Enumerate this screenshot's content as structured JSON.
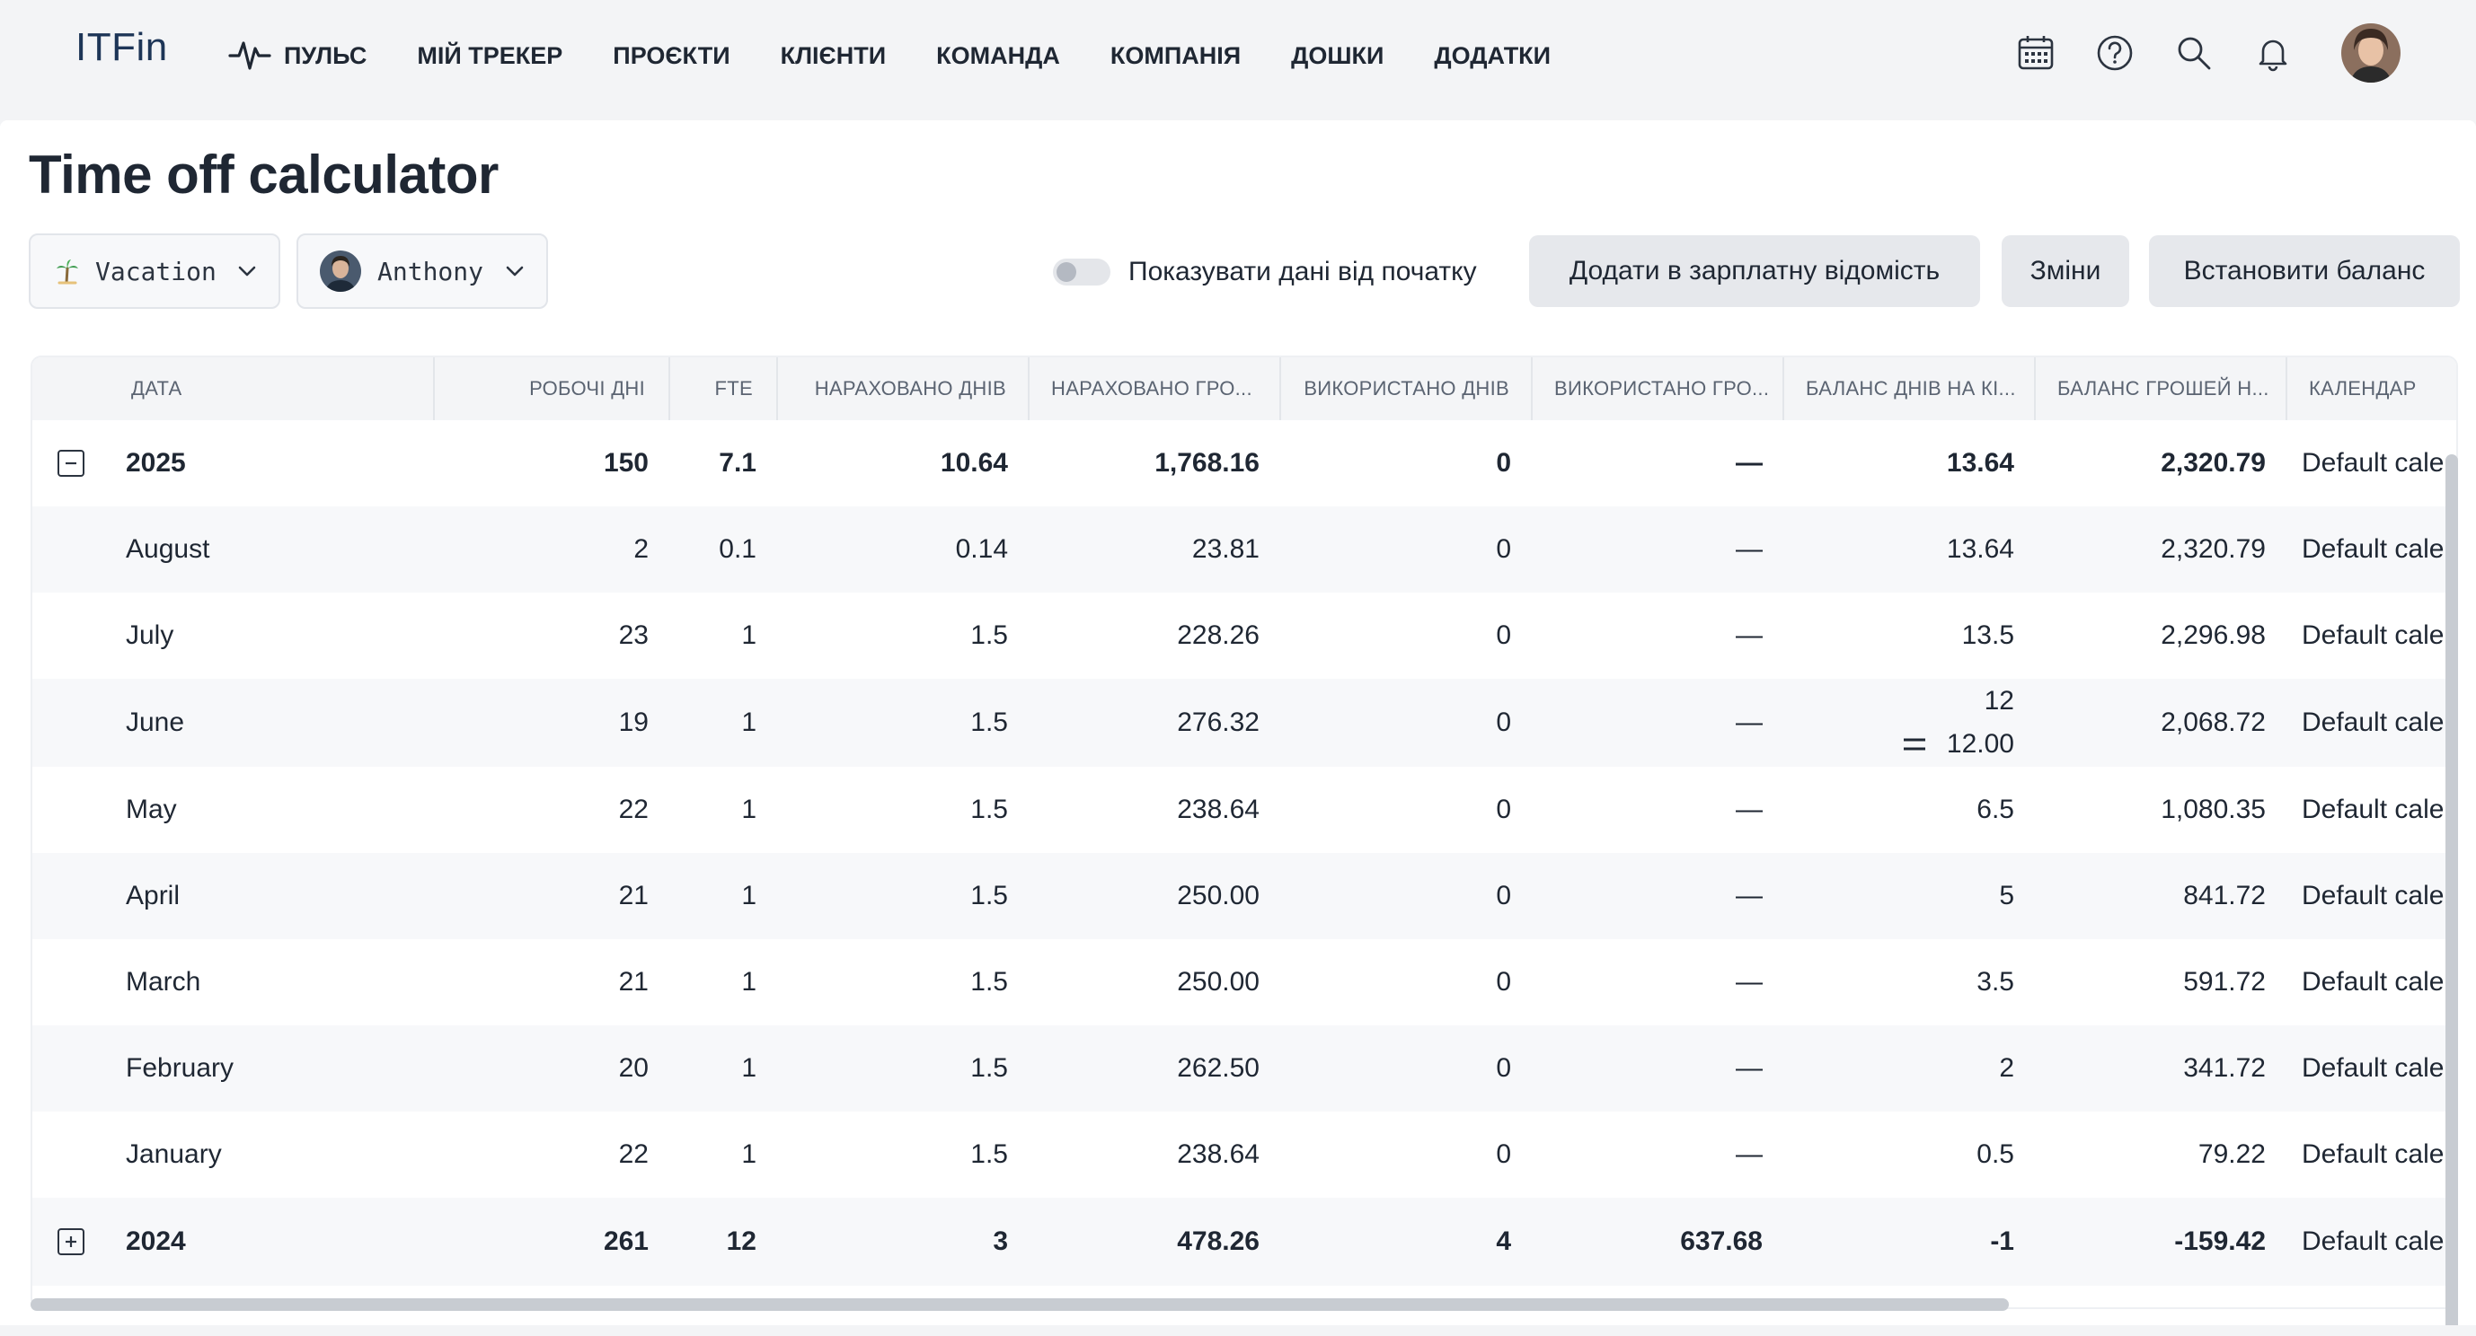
{
  "app": {
    "logo": "ITFin"
  },
  "nav": {
    "items": [
      {
        "label": "ПУЛЬС",
        "icon": "pulse-icon"
      },
      {
        "label": "МІЙ ТРЕКЕР"
      },
      {
        "label": "ПРОЄКТИ"
      },
      {
        "label": "КЛІЄНТИ"
      },
      {
        "label": "КОМАНДА"
      },
      {
        "label": "КОМПАНІЯ"
      },
      {
        "label": "ДОШКИ"
      },
      {
        "label": "ДОДАТКИ"
      }
    ],
    "icons": [
      "calendar-icon",
      "help-icon",
      "search-icon",
      "bell-icon",
      "avatar"
    ]
  },
  "page": {
    "title": "Time off calculator",
    "filters": {
      "type": {
        "value": "Vacation",
        "icon": "palm-tree-icon"
      },
      "user": {
        "value": "Anthony"
      }
    },
    "toggle": {
      "label": "Показувати дані від початку",
      "on": false
    },
    "buttons": {
      "payroll": "Додати в зарплатну відомість",
      "changes": "Зміни",
      "balance": "Встановити баланс"
    }
  },
  "table": {
    "columns": [
      "ДАТА",
      "РОБОЧІ ДНІ",
      "FTE",
      "НАРАХОВАНО ДНІВ",
      "НАРАХОВАНО ГРО...",
      "ВИКОРИСТАНО ДНІВ",
      "ВИКОРИСТАНО ГРО...",
      "БАЛАНС ДНІВ НА КІ...",
      "БАЛАНС ГРОШЕЙ Н...",
      "КАЛЕНДАР"
    ],
    "rows": [
      {
        "date": "2025",
        "work_days": "150",
        "fte": "7.1",
        "accrued_days": "10.64",
        "accrued_money": "1,768.16",
        "used_days": "0",
        "used_money": "—",
        "balance_days": "13.64",
        "balance_money": "2,320.79",
        "calendar": "Default cale",
        "group": true,
        "expanded": true
      },
      {
        "date": "August",
        "work_days": "2",
        "fte": "0.1",
        "accrued_days": "0.14",
        "accrued_money": "23.81",
        "used_days": "0",
        "used_money": "—",
        "balance_days": "13.64",
        "balance_money": "2,320.79",
        "calendar": "Default cale"
      },
      {
        "date": "July",
        "work_days": "23",
        "fte": "1",
        "accrued_days": "1.5",
        "accrued_money": "228.26",
        "used_days": "0",
        "used_money": "—",
        "balance_days": "13.5",
        "balance_money": "2,296.98",
        "calendar": "Default cale"
      },
      {
        "date": "June",
        "work_days": "19",
        "fte": "1",
        "accrued_days": "1.5",
        "accrued_money": "276.32",
        "used_days": "0",
        "used_money": "—",
        "balance_days": "12",
        "balance_days_set": "12.00",
        "balance_money": "2,068.72",
        "calendar": "Default cale"
      },
      {
        "date": "May",
        "work_days": "22",
        "fte": "1",
        "accrued_days": "1.5",
        "accrued_money": "238.64",
        "used_days": "0",
        "used_money": "—",
        "balance_days": "6.5",
        "balance_money": "1,080.35",
        "calendar": "Default cale"
      },
      {
        "date": "April",
        "work_days": "21",
        "fte": "1",
        "accrued_days": "1.5",
        "accrued_money": "250.00",
        "used_days": "0",
        "used_money": "—",
        "balance_days": "5",
        "balance_money": "841.72",
        "calendar": "Default cale"
      },
      {
        "date": "March",
        "work_days": "21",
        "fte": "1",
        "accrued_days": "1.5",
        "accrued_money": "250.00",
        "used_days": "0",
        "used_money": "—",
        "balance_days": "3.5",
        "balance_money": "591.72",
        "calendar": "Default cale"
      },
      {
        "date": "February",
        "work_days": "20",
        "fte": "1",
        "accrued_days": "1.5",
        "accrued_money": "262.50",
        "used_days": "0",
        "used_money": "—",
        "balance_days": "2",
        "balance_money": "341.72",
        "calendar": "Default cale"
      },
      {
        "date": "January",
        "work_days": "22",
        "fte": "1",
        "accrued_days": "1.5",
        "accrued_money": "238.64",
        "used_days": "0",
        "used_money": "—",
        "balance_days": "0.5",
        "balance_money": "79.22",
        "calendar": "Default cale"
      },
      {
        "date": "2024",
        "work_days": "261",
        "fte": "12",
        "accrued_days": "3",
        "accrued_money": "478.26",
        "used_days": "4",
        "used_money": "637.68",
        "balance_days": "-1",
        "balance_money": "-159.42",
        "calendar": "Default cale",
        "group": true,
        "expanded": false
      }
    ]
  },
  "colors": {
    "accent": "#1d3557",
    "text": "#1f2733",
    "header_bg": "#f4f5f7",
    "alt_row": "#f7f8fa"
  }
}
